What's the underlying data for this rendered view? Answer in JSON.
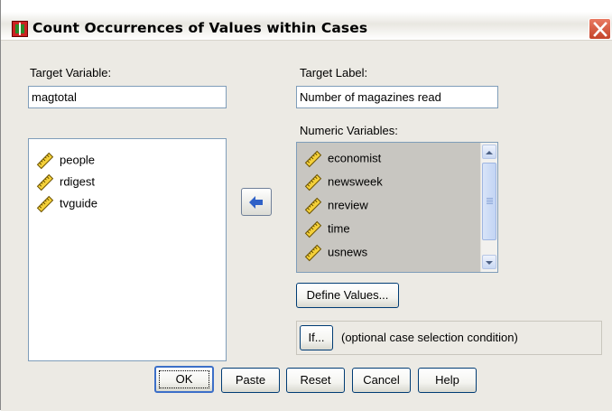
{
  "window": {
    "title": "Count Occurrences of Values within Cases",
    "icon": "spss-dialog-icon",
    "close_icon": "close-icon"
  },
  "target_variable": {
    "label": "Target Variable:",
    "value": "magtotal"
  },
  "target_label": {
    "label": "Target Label:",
    "value": "Number of magazines read"
  },
  "source_list": {
    "items": [
      {
        "label": "people",
        "icon": "scale-variable-icon"
      },
      {
        "label": "rdigest",
        "icon": "scale-variable-icon"
      },
      {
        "label": "tvguide",
        "icon": "scale-variable-icon"
      }
    ]
  },
  "move_button": {
    "icon": "arrow-left-icon"
  },
  "numeric_variables": {
    "label": "Numeric Variables:",
    "items": [
      {
        "label": "economist",
        "icon": "scale-variable-icon"
      },
      {
        "label": "newsweek",
        "icon": "scale-variable-icon"
      },
      {
        "label": "nreview",
        "icon": "scale-variable-icon"
      },
      {
        "label": "time",
        "icon": "scale-variable-icon"
      },
      {
        "label": "usnews",
        "icon": "scale-variable-icon"
      }
    ]
  },
  "define_values_button": {
    "label": "Define Values..."
  },
  "if_button": {
    "label": "If..."
  },
  "if_condition_text": "(optional case selection condition)",
  "footer": {
    "ok": "OK",
    "paste": "Paste",
    "reset": "Reset",
    "cancel": "Cancel",
    "help": "Help"
  },
  "colors": {
    "dialog_bg": "#eceae4",
    "selected_list_bg": "#c8c6c1",
    "field_border": "#7f9db9",
    "close_button": "#c4442a"
  }
}
